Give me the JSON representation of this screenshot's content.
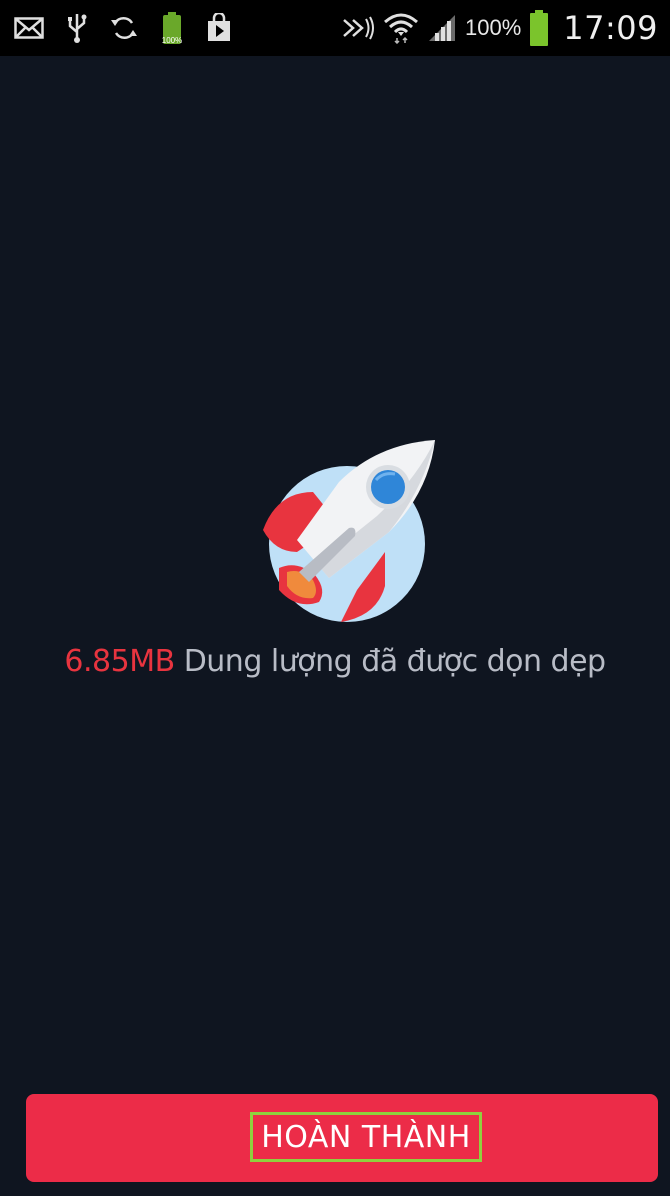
{
  "status_bar": {
    "battery_small_label": "100%",
    "battery_percent": "100%",
    "time": "17:09",
    "icons_left": [
      "mail-icon",
      "usb-icon",
      "sync-icon",
      "battery-charging-icon",
      "play-store-icon"
    ],
    "icons_right": [
      "nfc-icon",
      "wifi-icon",
      "signal-icon",
      "battery-icon"
    ]
  },
  "result": {
    "icon": "rocket-icon",
    "size_cleaned": "6.85MB",
    "message": " Dung lượng đã được dọn dẹp"
  },
  "done_button": {
    "label": "HOÀN THÀNH"
  },
  "colors": {
    "background": "#0f1520",
    "accent": "#ec2c48",
    "size_text": "#e8343f",
    "message_text": "#b8bcc6",
    "highlight_border": "#8fd13e"
  }
}
